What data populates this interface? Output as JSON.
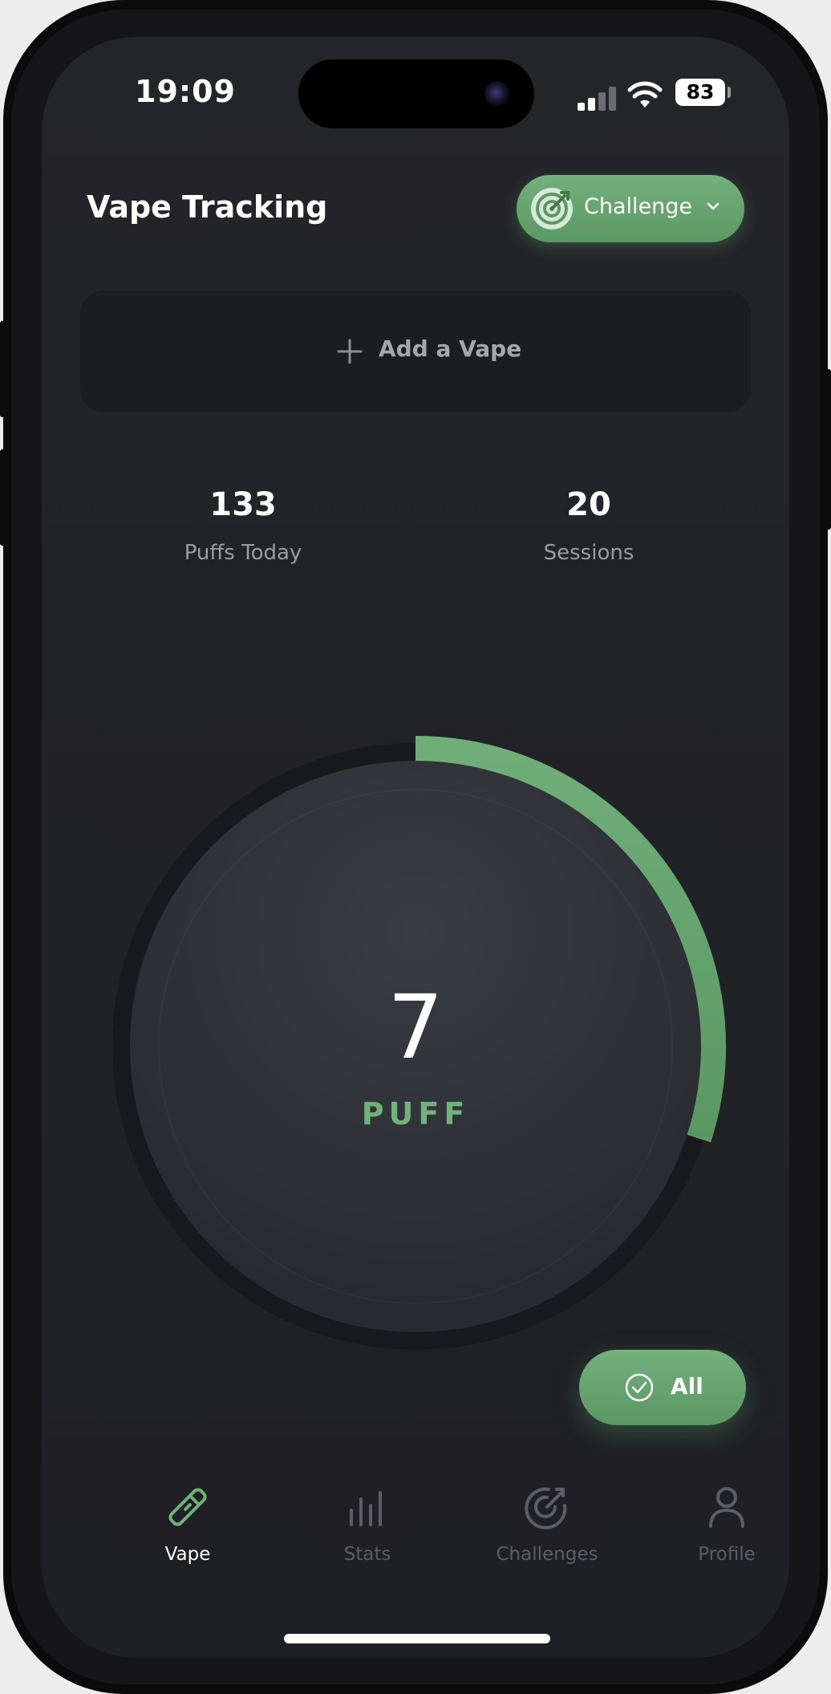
{
  "status_bar": {
    "time": "19:09",
    "battery": "83"
  },
  "header": {
    "title": "Vape Tracking",
    "challenge_button": "Challenge"
  },
  "add_vape": {
    "label": "Add a Vape"
  },
  "stats": [
    {
      "value": "133",
      "label": "Puffs Today"
    },
    {
      "value": "20",
      "label": "Sessions"
    }
  ],
  "puff_dial": {
    "count": "7",
    "label": "PUFF",
    "progress": 0.3
  },
  "filter_button": {
    "label": "All"
  },
  "tabs": [
    {
      "label": "Vape",
      "icon": "vape-pen-icon",
      "active": true
    },
    {
      "label": "Stats",
      "icon": "stats-icon",
      "active": false
    },
    {
      "label": "Challenges",
      "icon": "target-icon",
      "active": false
    },
    {
      "label": "Profile",
      "icon": "profile-icon",
      "active": false
    }
  ],
  "colors": {
    "accent": "#6fb27a",
    "background": "#222327",
    "card": "#1c1d21",
    "inactive": "#5d5e63"
  }
}
